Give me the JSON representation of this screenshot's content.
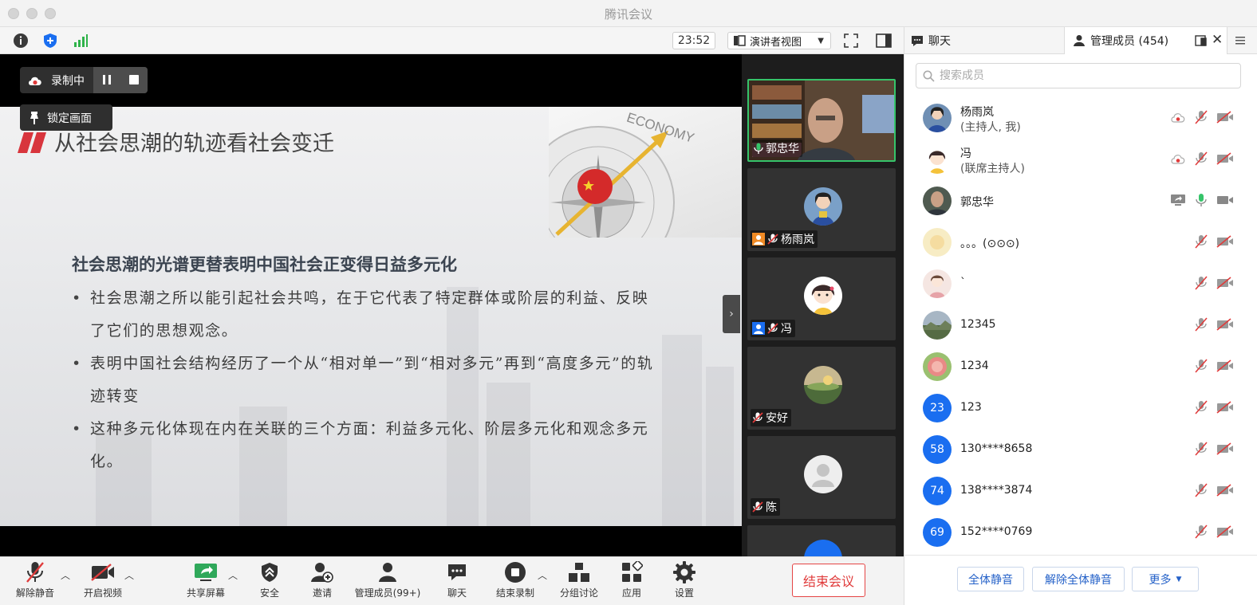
{
  "window": {
    "title": "腾讯会议"
  },
  "toolbar": {
    "time": "23:52",
    "view_mode": "演讲者视图"
  },
  "recording": {
    "status": "录制中",
    "lock_label": "锁定画面"
  },
  "slide": {
    "title": "从社会思潮的轨迹看社会变迁",
    "image_text": "ECONOMY",
    "heading": "社会思潮的光谱更替表明中国社会正变得日益多元化",
    "bullets": [
      "社会思潮之所以能引起社会共鸣，在于它代表了特定群体或阶层的利益、反映了它们的思想观念。",
      "表明中国社会结构经历了一个从“相对单一”到“相对多元”再到“高度多元”的轨迹转变",
      "这种多元化体现在内在关联的三个方面：利益多元化、阶层多元化和观念多元化。"
    ]
  },
  "gallery": [
    {
      "name": "郭忠华"
    },
    {
      "name": "杨雨岚"
    },
    {
      "name": "冯"
    },
    {
      "name": "安好"
    },
    {
      "name": "陈"
    }
  ],
  "bottombar": {
    "unmute": "解除静音",
    "video": "开启视频",
    "share": "共享屏幕",
    "security": "安全",
    "invite": "邀请",
    "manage": "管理成员(99+)",
    "chat": "聊天",
    "end_record": "结束录制",
    "breakout": "分组讨论",
    "apps": "应用",
    "settings": "设置",
    "end_meeting": "结束会议"
  },
  "panel": {
    "tab_chat": "聊天",
    "tab_members": "管理成员 (454)",
    "search_placeholder": "搜索成员",
    "members": [
      {
        "name": "杨雨岚",
        "role": "(主持人, 我)"
      },
      {
        "name": "冯",
        "role": "(联席主持人)"
      },
      {
        "name": "郭忠华"
      },
      {
        "name": "。。。(⊙⊙⊙)"
      },
      {
        "name": "`"
      },
      {
        "name": "12345"
      },
      {
        "name": "1234"
      },
      {
        "name": "123",
        "badge": "23"
      },
      {
        "name": "130****8658",
        "badge": "58"
      },
      {
        "name": "138****3874",
        "badge": "74"
      },
      {
        "name": "152****0769",
        "badge": "69"
      }
    ],
    "mute_all": "全体静音",
    "unmute_all": "解除全体静音",
    "more": "更多"
  },
  "colors": {
    "accent": "#1a6ef0",
    "active_speaker": "#36c46a",
    "danger": "#e03b3b"
  }
}
